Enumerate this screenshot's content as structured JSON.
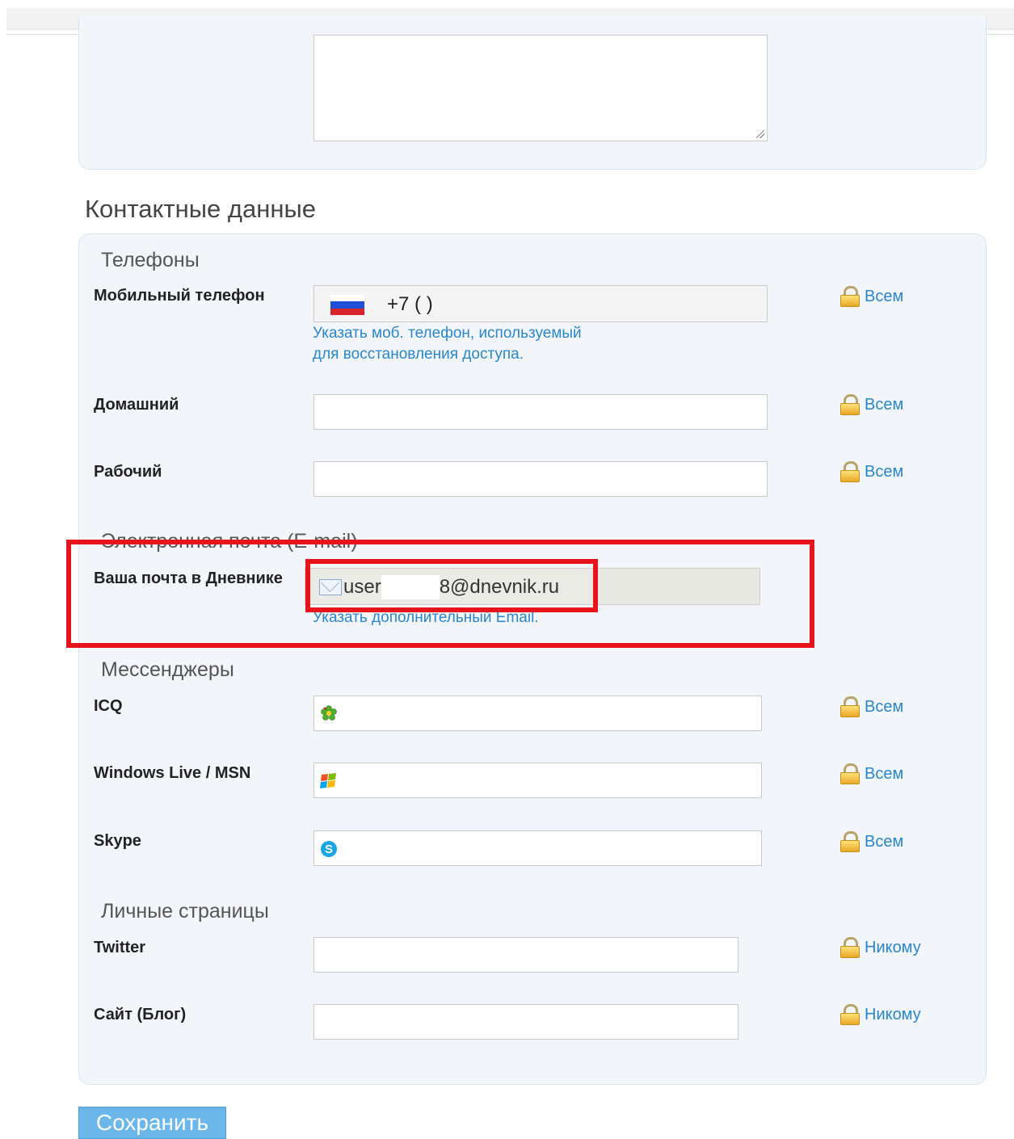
{
  "section_title": "Контактные данные",
  "groups": {
    "phones": "Телефоны",
    "email": "Электронная почта (E-mail)",
    "messengers": "Мессенджеры",
    "personal_pages": "Личные страницы"
  },
  "phones": {
    "mobile_label": "Мобильный телефон",
    "mobile_value": "+7 (     )",
    "mobile_hint_line1": "Указать моб. телефон, используемый",
    "mobile_hint_line2": "для восстановления доступа.",
    "home_label": "Домашний",
    "work_label": "Рабочий"
  },
  "email": {
    "label": "Ваша почта в Дневнике",
    "value_prefix": "user",
    "value_suffix": "8@dnevnik.ru",
    "hint": "Указать дополнительный Email."
  },
  "messengers": {
    "icq_label": "ICQ",
    "msn_label": "Windows Live / MSN",
    "skype_label": "Skype"
  },
  "pages": {
    "twitter_label": "Twitter",
    "site_label": "Сайт (Блог)"
  },
  "privacy": {
    "everyone": "Всем",
    "nobody": "Никому"
  },
  "save_label": "Сохранить",
  "colors": {
    "link": "#2a86c8",
    "highlight": "#e8141c",
    "button": "#6bb7ea"
  },
  "icons": [
    "lock-icon",
    "russia-flag-icon",
    "mail-icon",
    "icq-icon",
    "msn-icon",
    "skype-icon"
  ]
}
